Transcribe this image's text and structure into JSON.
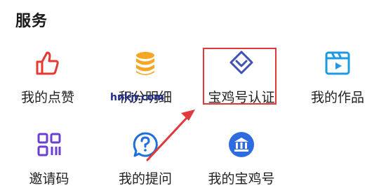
{
  "section": {
    "title": "服务"
  },
  "items": [
    {
      "label": "我的点赞",
      "icon": "thumbs-up-icon"
    },
    {
      "label": "积分明细",
      "icon": "coin-stack-icon"
    },
    {
      "label": "宝鸡号认证",
      "icon": "diamond-badge-icon"
    },
    {
      "label": "我的作品",
      "icon": "video-icon"
    },
    {
      "label": "邀请码",
      "icon": "qr-code-icon"
    },
    {
      "label": "我的提问",
      "icon": "question-bubble-icon"
    },
    {
      "label": "我的宝鸡号",
      "icon": "bank-building-icon"
    }
  ],
  "watermark": "hnkjr.com",
  "colors": {
    "thumb": "#e53935",
    "coin": "#f5a623",
    "diamond": "#3f51b5",
    "video": "#1e9be0",
    "qr": "#6a3fd1",
    "question": "#1e6fd9",
    "bank": "#2f6be0",
    "highlight": "#e0383b"
  }
}
